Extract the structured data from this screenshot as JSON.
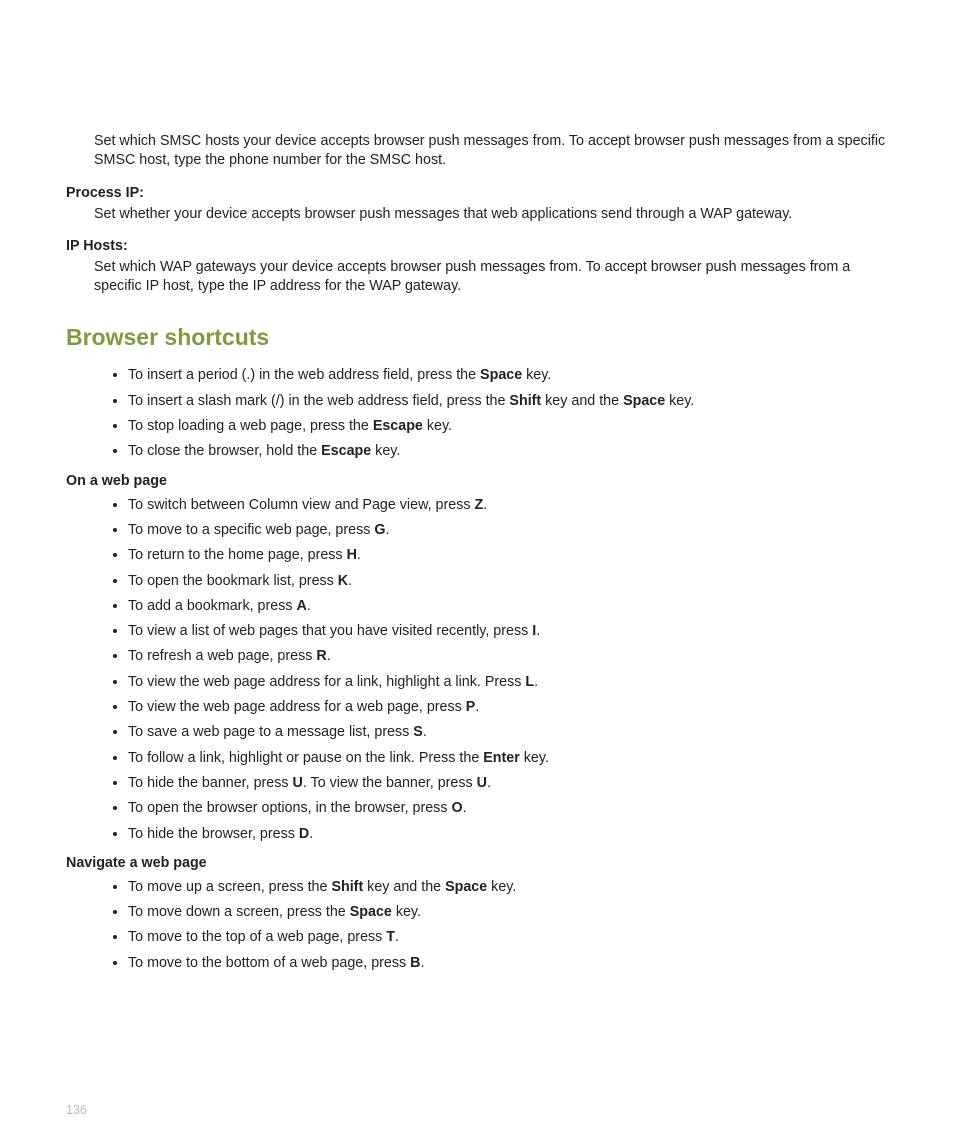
{
  "intro_para": "Set which SMSC hosts your device accepts browser push messages from. To accept browser push messages from a specific SMSC host, type the phone number for the SMSC host.",
  "defs": [
    {
      "term": "Process IP:",
      "body": "Set whether your device accepts browser push messages that web applications send through a WAP gateway."
    },
    {
      "term": "IP Hosts:",
      "body": "Set which WAP gateways your device accepts browser push messages from. To accept browser push messages from a specific IP host, type the IP address for the WAP gateway."
    }
  ],
  "section_title": "Browser shortcuts",
  "top_bullets": [
    {
      "pre": "To insert a period (.) in the web address field, press the ",
      "key": "Space",
      "post": " key."
    },
    {
      "pre": "To insert a slash mark (/) in the web address field, press the ",
      "key": "Shift",
      "mid": " key and the ",
      "key2": "Space",
      "post": " key."
    },
    {
      "pre": "To stop loading a web page, press the ",
      "key": "Escape",
      "post": " key."
    },
    {
      "pre": "To close the browser, hold the ",
      "key": "Escape",
      "post": " key."
    }
  ],
  "subheads": [
    "On a web page",
    "Navigate a web page"
  ],
  "onpage_bullets": [
    {
      "pre": "To switch between Column view and Page view, press ",
      "key": "Z",
      "post": "."
    },
    {
      "pre": "To move to a specific web page, press ",
      "key": "G",
      "post": "."
    },
    {
      "pre": "To return to the home page, press ",
      "key": "H",
      "post": "."
    },
    {
      "pre": "To open the bookmark list, press ",
      "key": "K",
      "post": "."
    },
    {
      "pre": "To add a bookmark, press ",
      "key": "A",
      "post": "."
    },
    {
      "pre": "To view a list of web pages that you have visited recently, press ",
      "key": "I",
      "post": "."
    },
    {
      "pre": "To refresh a web page, press ",
      "key": "R",
      "post": "."
    },
    {
      "pre": "To view the web page address for a link, highlight a link. Press ",
      "key": "L",
      "post": "."
    },
    {
      "pre": "To view the web page address for a web page, press ",
      "key": "P",
      "post": "."
    },
    {
      "pre": "To save a web page to a message list, press ",
      "key": "S",
      "post": "."
    },
    {
      "pre": "To follow a link, highlight or pause on the link. Press the ",
      "key": "Enter",
      "post": " key."
    },
    {
      "pre": "To hide the banner, press ",
      "key": "U",
      "mid": ". To view the banner, press ",
      "key2": "U",
      "post": "."
    },
    {
      "pre": "To open the browser options, in the browser, press ",
      "key": "O",
      "post": "."
    },
    {
      "pre": "To hide the browser, press ",
      "key": "D",
      "post": "."
    }
  ],
  "nav_bullets": [
    {
      "pre": "To move up a screen, press the ",
      "key": "Shift",
      "mid": " key and the ",
      "key2": "Space",
      "post": " key."
    },
    {
      "pre": "To move down a screen, press the ",
      "key": "Space",
      "post": " key."
    },
    {
      "pre": "To move to the top of a web page, press ",
      "key": "T",
      "post": "."
    },
    {
      "pre": "To move to the bottom of a web page, press ",
      "key": "B",
      "post": "."
    }
  ],
  "page_number": "136"
}
